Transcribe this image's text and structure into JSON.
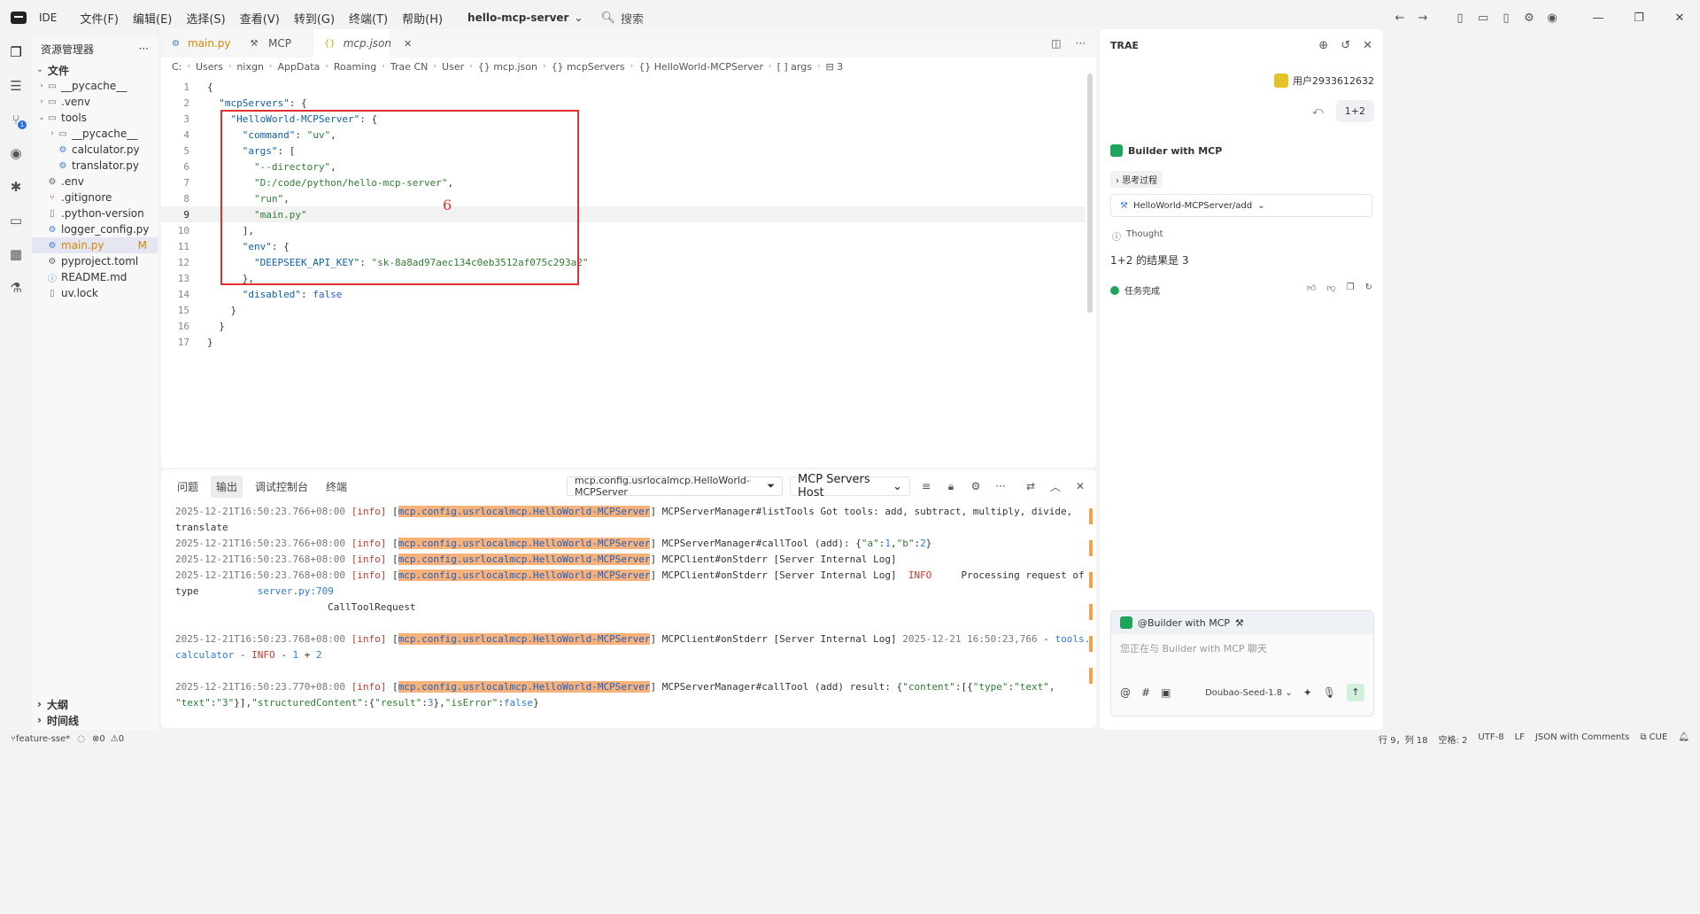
{
  "menu": {
    "ide": "IDE",
    "items": [
      "文件(F)",
      "编辑(E)",
      "选择(S)",
      "查看(V)",
      "转到(G)",
      "终端(T)",
      "帮助(H)"
    ],
    "project": "hello-mcp-server",
    "search": "搜索"
  },
  "explorer": {
    "title": "资源管理器",
    "section": "文件",
    "items": [
      {
        "name": "__pycache__",
        "type": "folder",
        "depth": 0
      },
      {
        "name": ".venv",
        "type": "folder",
        "depth": 0
      },
      {
        "name": "tools",
        "type": "folder-open",
        "depth": 0
      },
      {
        "name": "__pycache__",
        "type": "folder",
        "depth": 1
      },
      {
        "name": "calculator.py",
        "type": "py",
        "depth": 1
      },
      {
        "name": "translator.py",
        "type": "py",
        "depth": 1
      },
      {
        "name": ".env",
        "type": "gear",
        "depth": 0
      },
      {
        "name": ".gitignore",
        "type": "git",
        "depth": 0
      },
      {
        "name": ".python-version",
        "type": "file",
        "depth": 0
      },
      {
        "name": "logger_config.py",
        "type": "py",
        "depth": 0
      },
      {
        "name": "main.py",
        "type": "py",
        "depth": 0,
        "modified": "M",
        "active": true
      },
      {
        "name": "pyproject.toml",
        "type": "gear",
        "depth": 0
      },
      {
        "name": "README.md",
        "type": "info",
        "depth": 0
      },
      {
        "name": "uv.lock",
        "type": "file",
        "depth": 0
      }
    ],
    "outline": "大纲",
    "timeline": "时间线"
  },
  "tabs": [
    {
      "label": "main.py"
    },
    {
      "label": "MCP"
    },
    {
      "label": "mcp.json",
      "active": true
    }
  ],
  "breadcrumb": [
    "C:",
    "Users",
    "nixgn",
    "AppData",
    "Roaming",
    "Trae CN",
    "User",
    "{} mcp.json",
    "{} mcpServers",
    "{} HelloWorld-MCPServer",
    "[ ] args",
    "⊟ 3"
  ],
  "code": [
    [
      [
        "pun",
        "{"
      ]
    ],
    [
      [
        "pun",
        "  "
      ],
      [
        "key",
        "\"mcpServers\""
      ],
      [
        "pun",
        ": {"
      ]
    ],
    [
      [
        "pun",
        "    "
      ],
      [
        "key",
        "\"HelloWorld-MCPServer\""
      ],
      [
        "pun",
        ": {"
      ]
    ],
    [
      [
        "pun",
        "      "
      ],
      [
        "key",
        "\"command\""
      ],
      [
        "pun",
        ": "
      ],
      [
        "str",
        "\"uv\""
      ],
      [
        "pun",
        ","
      ]
    ],
    [
      [
        "pun",
        "      "
      ],
      [
        "key",
        "\"args\""
      ],
      [
        "pun",
        ": ["
      ]
    ],
    [
      [
        "pun",
        "        "
      ],
      [
        "str",
        "\"--directory\""
      ],
      [
        "pun",
        ","
      ]
    ],
    [
      [
        "pun",
        "        "
      ],
      [
        "str",
        "\"D:/code/python/hello-mcp-server\""
      ],
      [
        "pun",
        ","
      ]
    ],
    [
      [
        "pun",
        "        "
      ],
      [
        "str",
        "\"run\""
      ],
      [
        "pun",
        ","
      ]
    ],
    [
      [
        "pun",
        "        "
      ],
      [
        "str",
        "\"main.py\""
      ]
    ],
    [
      [
        "pun",
        "      ],"
      ]
    ],
    [
      [
        "pun",
        "      "
      ],
      [
        "key",
        "\"env\""
      ],
      [
        "pun",
        ": {"
      ]
    ],
    [
      [
        "pun",
        "        "
      ],
      [
        "key",
        "\"DEEPSEEK_API_KEY\""
      ],
      [
        "pun",
        ": "
      ],
      [
        "str",
        "\"sk-8a8ad97aec134c0eb3512af075c293a2\""
      ]
    ],
    [
      [
        "pun",
        "      },"
      ]
    ],
    [
      [
        "pun",
        "      "
      ],
      [
        "key",
        "\"disabled\""
      ],
      [
        "pun",
        ": "
      ],
      [
        "kw",
        "false"
      ]
    ],
    [
      [
        "pun",
        "    }"
      ]
    ],
    [
      [
        "pun",
        "  }"
      ]
    ],
    [
      [
        "pun",
        "}"
      ]
    ]
  ],
  "current_line": 9,
  "annotation": "6",
  "panel": {
    "tabs": [
      "问题",
      "输出",
      "调试控制台",
      "终端"
    ],
    "active": 1,
    "filter": "mcp.config.usrlocalmcp.HelloWorld-MCPServer",
    "host": "MCP Servers Host"
  },
  "log": [
    [
      [
        "dim",
        "2025-12-21T16:50:23.766+08:00 "
      ],
      [
        "info",
        "[info]"
      ],
      [
        "p",
        " ["
      ],
      [
        "tag",
        "mcp.config.usrlocalmcp.HelloWorld-MCPServer"
      ],
      [
        "p",
        "] MCPServerManager#listTools Got tools: add, subtract, multiply, divide,"
      ]
    ],
    [
      [
        "p",
        "translate"
      ]
    ],
    [
      [
        "dim",
        "2025-12-21T16:50:23.766+08:00 "
      ],
      [
        "info",
        "[info]"
      ],
      [
        "p",
        " ["
      ],
      [
        "tag",
        "mcp.config.usrlocalmcp.HelloWorld-MCPServer"
      ],
      [
        "p",
        "] MCPServerManager#callTool (add): {"
      ],
      [
        "str",
        "\"a\""
      ],
      [
        "p",
        ":"
      ],
      [
        "lblue",
        "1"
      ],
      [
        "p",
        ","
      ],
      [
        "str",
        "\"b\""
      ],
      [
        "p",
        ":"
      ],
      [
        "lblue",
        "2"
      ],
      [
        "p",
        "}"
      ]
    ],
    [
      [
        "dim",
        "2025-12-21T16:50:23.768+08:00 "
      ],
      [
        "info",
        "[info]"
      ],
      [
        "p",
        " ["
      ],
      [
        "tag",
        "mcp.config.usrlocalmcp.HelloWorld-MCPServer"
      ],
      [
        "p",
        "] MCPClient#onStderr [Server Internal Log]"
      ]
    ],
    [
      [
        "dim",
        "2025-12-21T16:50:23.768+08:00 "
      ],
      [
        "info",
        "[info]"
      ],
      [
        "p",
        " ["
      ],
      [
        "tag",
        "mcp.config.usrlocalmcp.HelloWorld-MCPServer"
      ],
      [
        "p",
        "] MCPClient#onStderr [Server Internal Log]  "
      ],
      [
        "info",
        "INFO"
      ],
      [
        "p",
        "     Processing request of"
      ]
    ],
    [
      [
        "p",
        "type          "
      ],
      [
        "lblue",
        "server.py:709"
      ]
    ],
    [
      [
        "p",
        "                          CallToolRequest"
      ]
    ],
    [
      [
        "p",
        ""
      ]
    ],
    [
      [
        "dim",
        "2025-12-21T16:50:23.768+08:00 "
      ],
      [
        "info",
        "[info]"
      ],
      [
        "p",
        " ["
      ],
      [
        "tag",
        "mcp.config.usrlocalmcp.HelloWorld-MCPServer"
      ],
      [
        "p",
        "] MCPClient#onStderr [Server Internal Log] "
      ],
      [
        "dim",
        "2025-12-21 16:50:23,766"
      ],
      [
        "p",
        " - "
      ],
      [
        "lblue",
        "tools."
      ]
    ],
    [
      [
        "lblue",
        "calculator"
      ],
      [
        "p",
        " - "
      ],
      [
        "info",
        "INFO"
      ],
      [
        "p",
        " - "
      ],
      [
        "lblue",
        "1"
      ],
      [
        "p",
        " + "
      ],
      [
        "lblue",
        "2"
      ]
    ],
    [
      [
        "p",
        ""
      ]
    ],
    [
      [
        "dim",
        "2025-12-21T16:50:23.770+08:00 "
      ],
      [
        "info",
        "[info]"
      ],
      [
        "p",
        " ["
      ],
      [
        "tag",
        "mcp.config.usrlocalmcp.HelloWorld-MCPServer"
      ],
      [
        "p",
        "] MCPServerManager#callTool (add) result: {"
      ],
      [
        "str",
        "\"content\""
      ],
      [
        "p",
        ":[{"
      ],
      [
        "str",
        "\"type\""
      ],
      [
        "p",
        ":"
      ],
      [
        "str",
        "\"text\""
      ],
      [
        "p",
        ","
      ]
    ],
    [
      [
        "str",
        "\"text\""
      ],
      [
        "p",
        ":"
      ],
      [
        "str",
        "\"3\""
      ],
      [
        "p",
        "}],"
      ],
      [
        "str",
        "\"structuredContent\""
      ],
      [
        "p",
        ":{"
      ],
      [
        "str",
        "\"result\""
      ],
      [
        "p",
        ":"
      ],
      [
        "lblue",
        "3"
      ],
      [
        "p",
        "},"
      ],
      [
        "str",
        "\"isError\""
      ],
      [
        "p",
        ":"
      ],
      [
        "lblue",
        "false"
      ],
      [
        "p",
        "}"
      ]
    ]
  ],
  "status": {
    "branch": "feature-sse*",
    "errors": "0",
    "warnings": "0",
    "cursor": "行 9，列 18",
    "spaces": "空格: 2",
    "encoding": "UTF-8",
    "eol": "LF",
    "language": "JSON with Comments",
    "cue": "CUE"
  },
  "chat": {
    "title": "TRAE",
    "user": "用户2933612632",
    "question": "1+2",
    "agent": "Builder with MCP",
    "think": "思考过程",
    "toolcall": "HelloWorld-MCPServer/add",
    "thought": "Thought",
    "result": "1+2 的结果是 3",
    "done": "任务完成",
    "input_agent": "@Builder with MCP",
    "placeholder": "您正在与 Builder with MCP 聊天",
    "model": "Doubao-Seed-1.8"
  }
}
